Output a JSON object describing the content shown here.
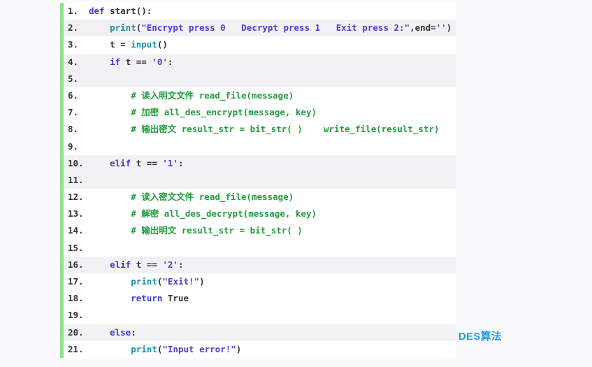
{
  "code_block": {
    "language": "python",
    "accent_color": "#8ce58c",
    "background": "#ffffff",
    "shaded_row_color": "#f2f2f5",
    "lines": [
      {
        "number": "1.",
        "shaded": false,
        "tokens": [
          {
            "t": "def ",
            "c": "kw"
          },
          {
            "t": "start",
            "c": "plain"
          },
          {
            "t": "():",
            "c": "punc"
          }
        ]
      },
      {
        "number": "2.",
        "shaded": true,
        "tokens": [
          {
            "t": "    ",
            "c": "plain"
          },
          {
            "t": "print",
            "c": "builtin"
          },
          {
            "t": "(",
            "c": "punc"
          },
          {
            "t": "\"Encrypt press 0   Decrypt press 1   Exit press 2:\"",
            "c": "str"
          },
          {
            "t": ",end=",
            "c": "punc"
          },
          {
            "t": "''",
            "c": "str"
          },
          {
            "t": ")",
            "c": "punc"
          }
        ]
      },
      {
        "number": "3.",
        "shaded": false,
        "tokens": [
          {
            "t": "    t = ",
            "c": "plain"
          },
          {
            "t": "input",
            "c": "builtin"
          },
          {
            "t": "()",
            "c": "punc"
          }
        ]
      },
      {
        "number": "4.",
        "shaded": true,
        "tokens": [
          {
            "t": "    ",
            "c": "plain"
          },
          {
            "t": "if ",
            "c": "kw"
          },
          {
            "t": "t == ",
            "c": "plain"
          },
          {
            "t": "'0'",
            "c": "str"
          },
          {
            "t": ":",
            "c": "punc"
          }
        ]
      },
      {
        "number": "5.",
        "shaded": true,
        "tokens": [
          {
            "t": "",
            "c": "plain"
          }
        ]
      },
      {
        "number": "6.",
        "shaded": false,
        "tokens": [
          {
            "t": "        # 读入明文文件 read_file(message)",
            "c": "comment"
          }
        ]
      },
      {
        "number": "7.",
        "shaded": false,
        "tokens": [
          {
            "t": "        # 加密 all_des_encrypt(message, key)",
            "c": "comment"
          }
        ]
      },
      {
        "number": "8.",
        "shaded": false,
        "tokens": [
          {
            "t": "        # 输出密文 result_str = bit_str( )    write_file(result_str)",
            "c": "comment"
          }
        ]
      },
      {
        "number": "9.",
        "shaded": false,
        "tokens": [
          {
            "t": "",
            "c": "plain"
          }
        ]
      },
      {
        "number": "10.",
        "shaded": true,
        "tokens": [
          {
            "t": "    ",
            "c": "plain"
          },
          {
            "t": "elif ",
            "c": "kw"
          },
          {
            "t": "t == ",
            "c": "plain"
          },
          {
            "t": "'1'",
            "c": "str"
          },
          {
            "t": ":",
            "c": "punc"
          }
        ]
      },
      {
        "number": "11.",
        "shaded": true,
        "tokens": [
          {
            "t": "",
            "c": "plain"
          }
        ]
      },
      {
        "number": "12.",
        "shaded": false,
        "tokens": [
          {
            "t": "        # 读入密文文件 read_file(message)",
            "c": "comment"
          }
        ]
      },
      {
        "number": "13.",
        "shaded": false,
        "tokens": [
          {
            "t": "        # 解密 all_des_decrypt(message, key)",
            "c": "comment"
          }
        ]
      },
      {
        "number": "14.",
        "shaded": false,
        "tokens": [
          {
            "t": "        # 输出明文 result_str = bit_str( )",
            "c": "comment"
          }
        ]
      },
      {
        "number": "15.",
        "shaded": false,
        "tokens": [
          {
            "t": "",
            "c": "plain"
          }
        ]
      },
      {
        "number": "16.",
        "shaded": true,
        "tokens": [
          {
            "t": "    ",
            "c": "plain"
          },
          {
            "t": "elif ",
            "c": "kw"
          },
          {
            "t": "t == ",
            "c": "plain"
          },
          {
            "t": "'2'",
            "c": "str"
          },
          {
            "t": ":",
            "c": "punc"
          }
        ]
      },
      {
        "number": "17.",
        "shaded": false,
        "tokens": [
          {
            "t": "        ",
            "c": "plain"
          },
          {
            "t": "print",
            "c": "builtin"
          },
          {
            "t": "(",
            "c": "punc"
          },
          {
            "t": "\"Exit!\"",
            "c": "str"
          },
          {
            "t": ")",
            "c": "punc"
          }
        ]
      },
      {
        "number": "18.",
        "shaded": false,
        "tokens": [
          {
            "t": "        ",
            "c": "plain"
          },
          {
            "t": "return ",
            "c": "kw"
          },
          {
            "t": "True",
            "c": "plain"
          }
        ]
      },
      {
        "number": "19.",
        "shaded": false,
        "tokens": [
          {
            "t": "",
            "c": "plain"
          }
        ]
      },
      {
        "number": "20.",
        "shaded": true,
        "tokens": [
          {
            "t": "    ",
            "c": "plain"
          },
          {
            "t": "else",
            "c": "kw"
          },
          {
            "t": ":",
            "c": "punc"
          }
        ]
      },
      {
        "number": "21.",
        "shaded": false,
        "tokens": [
          {
            "t": "        ",
            "c": "plain"
          },
          {
            "t": "print",
            "c": "builtin"
          },
          {
            "t": "(",
            "c": "punc"
          },
          {
            "t": "\"Input error!\"",
            "c": "str"
          },
          {
            "t": ")",
            "c": "punc"
          }
        ]
      }
    ]
  },
  "des_label": {
    "text": "DES算法",
    "color": "#1f9fe0"
  },
  "watermark": {
    "text": "https://blog.csdn.net/qq_47912072"
  }
}
